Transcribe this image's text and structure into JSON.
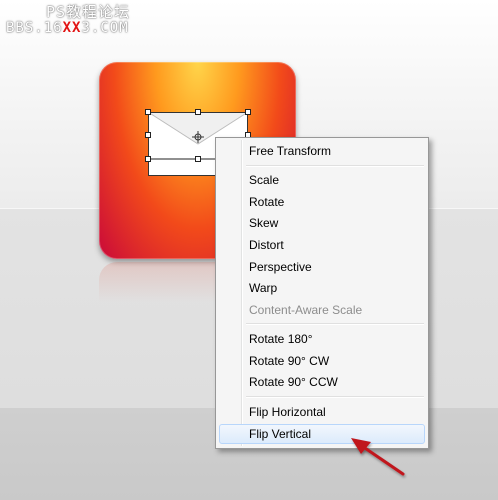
{
  "watermark": {
    "line1": "PS教程论坛",
    "line2_prefix": "BBS.16",
    "line2_highlight": "XX",
    "line2_suffix": "3.COM"
  },
  "context_menu": {
    "items": [
      {
        "label": "Free Transform",
        "enabled": true
      },
      {
        "label": "Scale",
        "enabled": true
      },
      {
        "label": "Rotate",
        "enabled": true
      },
      {
        "label": "Skew",
        "enabled": true
      },
      {
        "label": "Distort",
        "enabled": true
      },
      {
        "label": "Perspective",
        "enabled": true
      },
      {
        "label": "Warp",
        "enabled": true
      },
      {
        "label": "Content-Aware Scale",
        "enabled": false
      },
      {
        "label": "Rotate 180°",
        "enabled": true
      },
      {
        "label": "Rotate 90° CW",
        "enabled": true
      },
      {
        "label": "Rotate 90° CCW",
        "enabled": true
      },
      {
        "label": "Flip Horizontal",
        "enabled": true
      },
      {
        "label": "Flip Vertical",
        "enabled": true,
        "selected": true
      }
    ]
  },
  "icons": {
    "app_icon": "envelope-app-icon",
    "crosshair": "reference-point-icon",
    "arrow": "red-pointer-arrow"
  },
  "colors": {
    "icon_top": "#ffd54a",
    "icon_bottom": "#c9093a",
    "arrow": "#c0141c",
    "selection_border": "#b8d6fb"
  }
}
